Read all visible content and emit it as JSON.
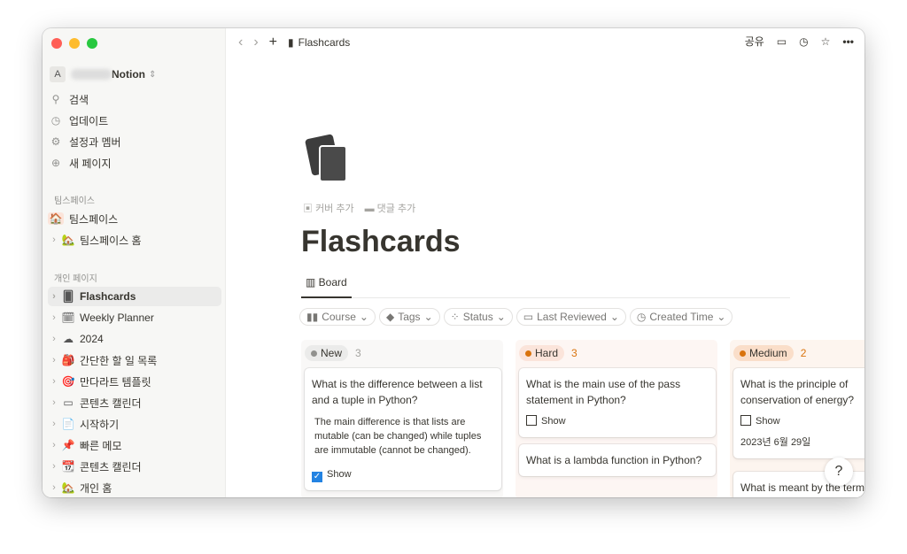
{
  "window": {
    "title": "Flashcards"
  },
  "sidebar": {
    "workspace_initial": "A",
    "workspace_name": "Notion",
    "top_items": [
      {
        "label": "검색",
        "icon": "search-icon"
      },
      {
        "label": "업데이트",
        "icon": "clock-icon"
      },
      {
        "label": "설정과 멤버",
        "icon": "gear-icon"
      },
      {
        "label": "새 페이지",
        "icon": "plus-circle-icon"
      }
    ],
    "teamspace_header": "팀스페이스",
    "teamspace_items": [
      {
        "label": "팀스페이스",
        "icon": "🏠"
      },
      {
        "label": "팀스페이스 홈",
        "icon": "🏡"
      }
    ],
    "private_header": "개인 페이지",
    "private_items": [
      {
        "label": "Flashcards",
        "icon": "🂠"
      },
      {
        "label": "Weekly Planner",
        "icon": "🗓"
      },
      {
        "label": "2024",
        "icon": "☁"
      },
      {
        "label": "간단한 할 일 목록",
        "icon": "🎒"
      },
      {
        "label": "만다라트 템플릿",
        "icon": "🎯"
      },
      {
        "label": "콘텐츠 캘린더",
        "icon": "▭"
      },
      {
        "label": "시작하기",
        "icon": "📄"
      },
      {
        "label": "빠른 메모",
        "icon": "📌"
      },
      {
        "label": "콘텐츠 캘린더",
        "icon": "📆"
      },
      {
        "label": "개인 홈",
        "icon": "🏡"
      }
    ]
  },
  "topbar": {
    "breadcrumb": "Flashcards",
    "share": "공유"
  },
  "page": {
    "add_cover": "커버 추가",
    "add_comment": "댓글 추가",
    "title": "Flashcards",
    "view_tab": "Board",
    "filters": [
      "Course",
      "Tags",
      "Status",
      "Last Reviewed",
      "Created Time"
    ]
  },
  "board": {
    "columns": [
      {
        "name": "New",
        "count": "3",
        "color": "#91918e",
        "bg": "#ebebea",
        "cards": [
          {
            "q": "What is the difference between a list and a tuple in Python?",
            "a": "The main difference is that lists are mutable (can be changed) while tuples are immutable (cannot be changed).",
            "show": "Show",
            "checked": true
          }
        ]
      },
      {
        "name": "Hard",
        "count": "3",
        "color": "#d9730d",
        "bg": "#fbe4da",
        "cards": [
          {
            "q": "What is the main use of the pass statement in Python?",
            "show": "Show",
            "checked": false
          },
          {
            "q": "What is a lambda function in Python?"
          }
        ]
      },
      {
        "name": "Medium",
        "count": "2",
        "color": "#d9730d",
        "bg": "#fadec9",
        "cards": [
          {
            "q": "What is the principle of conservation of energy?",
            "show": "Show",
            "checked": false,
            "date": "2023년 6월 29일"
          },
          {
            "q": "What is meant by the term"
          }
        ]
      }
    ]
  },
  "help": "?"
}
